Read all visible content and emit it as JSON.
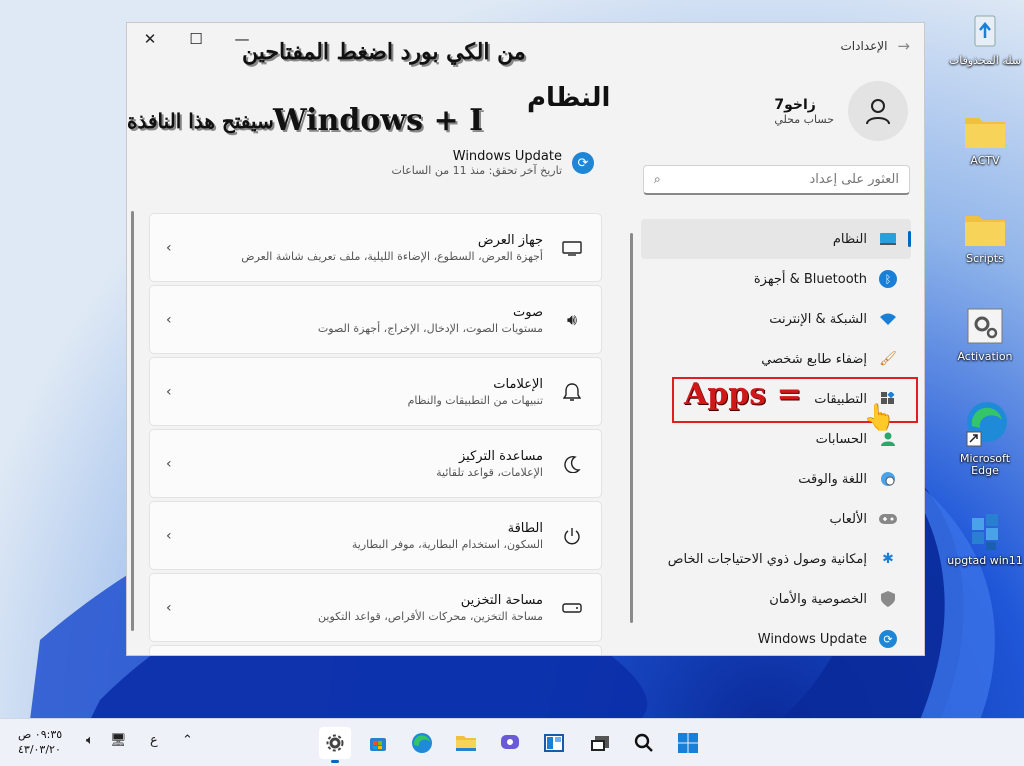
{
  "window": {
    "title": "الإعدادات",
    "minimize": "—",
    "maximize": "☐",
    "close": "✕"
  },
  "profile": {
    "name": "زاخو7",
    "account_type": "حساب محلي"
  },
  "search": {
    "placeholder": "العثور على إعداد"
  },
  "nav": {
    "items": [
      {
        "label": "النظام",
        "icon": "system-icon",
        "selected": true
      },
      {
        "label": "أجهزة & Bluetooth",
        "icon": "bluetooth-icon"
      },
      {
        "label": "الشبكة & الإنترنت",
        "icon": "wifi-icon"
      },
      {
        "label": "إضفاء طابع شخصي",
        "icon": "brush-icon"
      },
      {
        "label": "التطبيقات",
        "icon": "apps-icon"
      },
      {
        "label": "الحسابات",
        "icon": "accounts-icon"
      },
      {
        "label": "اللغة والوقت",
        "icon": "globe-clock-icon"
      },
      {
        "label": "الألعاب",
        "icon": "gamepad-icon"
      },
      {
        "label": "إمكانية وصول ذوي الاحتياجات الخاص",
        "icon": "accessibility-icon"
      },
      {
        "label": "الخصوصية والأمان",
        "icon": "shield-icon"
      },
      {
        "label": "Windows Update",
        "icon": "update-icon"
      }
    ]
  },
  "page": {
    "title": "النظام",
    "update_title": "Windows Update",
    "update_subtitle": "تاريخ آخر تحقق: منذ 11 من الساعات"
  },
  "cards": [
    {
      "title": "جهاز العرض",
      "desc": "أجهزة العرض، السطوع، الإضاءة الليلية، ملف تعريف شاشة العرض",
      "icon": "display-icon"
    },
    {
      "title": "صوت",
      "desc": "مستويات الصوت، الإدخال، الإخراج، أجهزة الصوت",
      "icon": "speaker-icon"
    },
    {
      "title": "الإعلامات",
      "desc": "تنبيهات من التطبيقات والنظام",
      "icon": "bell-icon"
    },
    {
      "title": "مساعدة التركيز",
      "desc": "الإعلامات، قواعد تلقائية",
      "icon": "moon-icon"
    },
    {
      "title": "الطاقة",
      "desc": "السكون، استخدام البطارية، موفر البطارية",
      "icon": "power-icon"
    },
    {
      "title": "مساحة التخزين",
      "desc": "مساحة التخزين، محركات الأقراص، قواعد التكوين",
      "icon": "storage-icon"
    }
  ],
  "annotations": {
    "line1": "من الكي بورد اضغط المفتاحين",
    "line2_keys": "Windows + I",
    "line2_text": "سيفتح هذا النافذة",
    "apps_label": "Apps  ="
  },
  "desktop_icons": [
    {
      "label": "سلة المحذوفات",
      "icon": "recycle-bin-icon"
    },
    {
      "label": "ACTV",
      "icon": "folder-icon"
    },
    {
      "label": "Scripts",
      "icon": "folder-icon"
    },
    {
      "label": "Activation",
      "icon": "settings-file-icon"
    },
    {
      "label": "Microsoft Edge",
      "icon": "edge-icon"
    },
    {
      "label": "upgtad win11",
      "icon": "package-icon"
    }
  ],
  "taskbar": {
    "time": "٠٩:٣٥ ص",
    "date": "٤٣/٠٣/٢٠",
    "lang": "ع",
    "pinned": [
      "settings-icon",
      "store-icon",
      "edge-icon",
      "explorer-icon",
      "chat-icon",
      "widgets-icon",
      "taskview-icon",
      "search-icon",
      "start-icon"
    ]
  },
  "colors": {
    "accent": "#0067c0",
    "annotation_red": "#d01818"
  }
}
